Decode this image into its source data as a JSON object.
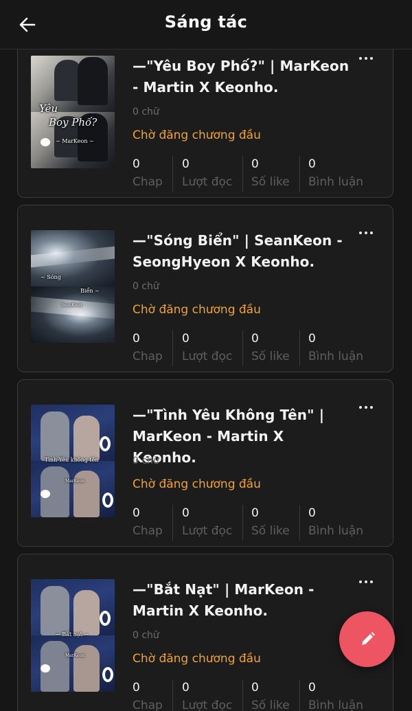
{
  "header": {
    "title": "Sáng tác"
  },
  "stat_labels": {
    "chap": "Chap",
    "reads": "Lượt đọc",
    "likes": "Số like",
    "comments": "Bình luận"
  },
  "stories": [
    {
      "title": "—\"Yêu Boy Phố?\" | MarKeon - Martin X Keonho.",
      "word_count": "0 chữ",
      "status": "Chờ đăng chương đầu",
      "cover_text_1": "Yêu",
      "cover_text_2": "Boy Phố?",
      "cover_text_3": "~ MarKeon ~",
      "stats": {
        "chap": "0",
        "reads": "0",
        "likes": "0",
        "comments": "0"
      }
    },
    {
      "title": "—\"Sóng Biển\" | SeanKeon - SeongHyeon X Keonho.",
      "word_count": "0 chữ",
      "status": "Chờ đăng chương đầu",
      "cover_text_1": "~ Sóng",
      "cover_text_2": "Biển ~",
      "cover_text_3": "SeanKeon",
      "stats": {
        "chap": "0",
        "reads": "0",
        "likes": "0",
        "comments": "0"
      }
    },
    {
      "title": "—\"Tình Yêu Không Tên\" | MarKeon - Martin X Keonho.",
      "word_count": "0 chữ",
      "status": "Chờ đăng chương đầu",
      "cover_text_1": "Tình Yêu không tên",
      "cover_text_2": "MarKeon",
      "cover_text_3": "",
      "stats": {
        "chap": "0",
        "reads": "0",
        "likes": "0",
        "comments": "0"
      }
    },
    {
      "title": "—\"Bắt Nạt\" | MarKeon - Martin X Keonho.",
      "word_count": "0 chữ",
      "status": "Chờ đăng chương đầu",
      "cover_text_1": "~ Bắt nạt ~",
      "cover_text_2": "MarKeon",
      "cover_text_3": "",
      "stats": {
        "chap": "0",
        "reads": "0",
        "likes": "0",
        "comments": "0"
      }
    }
  ],
  "icons": {
    "back": "arrow-left-icon",
    "more": "more-horizontal-icon",
    "fab": "pencil-icon"
  },
  "colors": {
    "status": "#f0a42a",
    "fab": "#ee5563",
    "background": "#161616"
  }
}
